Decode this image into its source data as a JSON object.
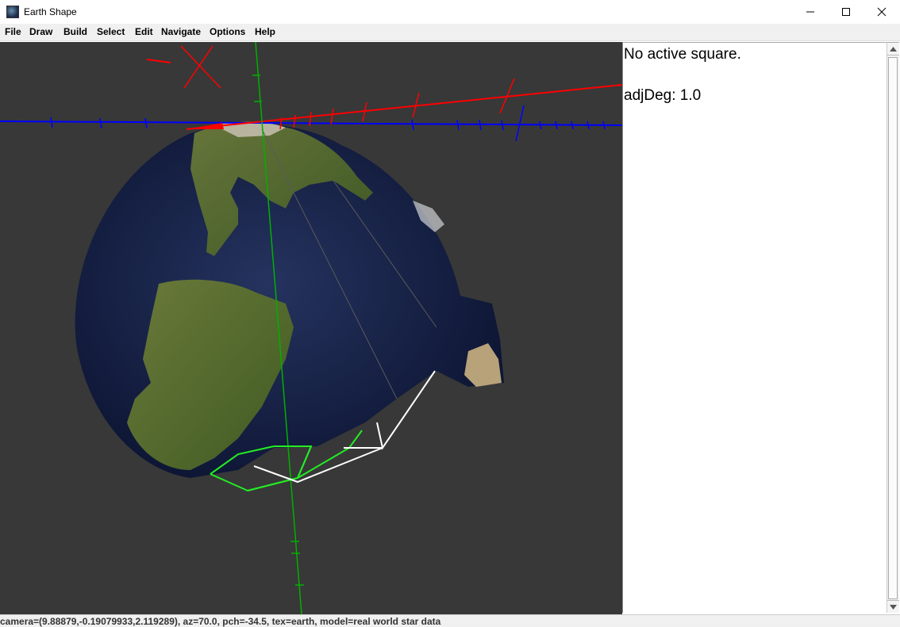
{
  "window": {
    "title": "Earth Shape",
    "app_icon": "earth-app-icon",
    "controls": [
      "minimize-icon",
      "maximize-icon",
      "close-icon"
    ]
  },
  "menu": {
    "items": [
      "File",
      "Draw",
      "Build",
      "Select",
      "Edit",
      "Navigate",
      "Options",
      "Help"
    ]
  },
  "viewport": {
    "background": "#383838",
    "axis_colors": {
      "x": "#ff0000",
      "y": "#00cc00",
      "z": "#0000ff"
    },
    "texture": "earth"
  },
  "side_panel": {
    "line1": "No active square.",
    "line2": "adjDeg: 1.0"
  },
  "status": {
    "text": "camera=(9.88879,-0.19079933,2.119289), az=70.0, pch=-34.5, tex=earth, model=real world star data"
  }
}
